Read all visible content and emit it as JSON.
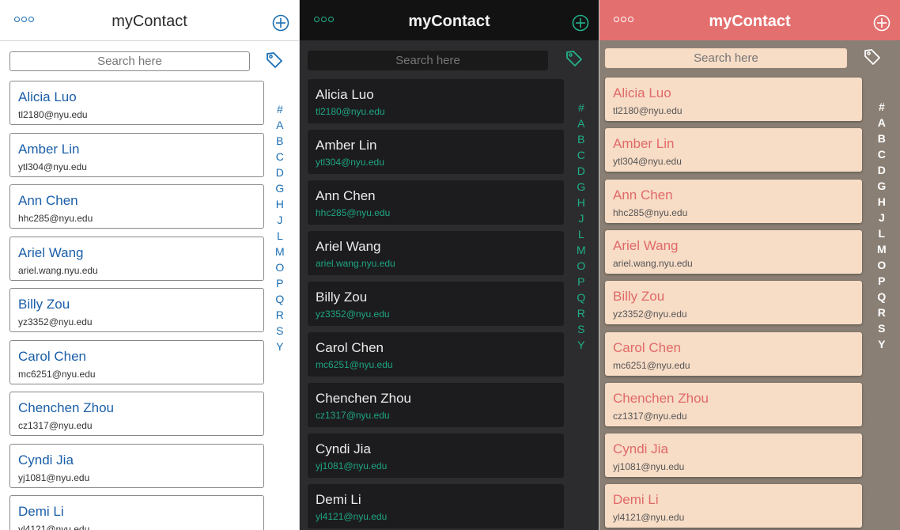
{
  "app": {
    "title": "myContact"
  },
  "search": {
    "placeholder": "Search here"
  },
  "contacts": [
    {
      "name": "Alicia Luo",
      "email": "tl2180@nyu.edu"
    },
    {
      "name": "Amber Lin",
      "email": "ytl304@nyu.edu"
    },
    {
      "name": "Ann Chen",
      "email": "hhc285@nyu.edu"
    },
    {
      "name": "Ariel Wang",
      "email": "ariel.wang.nyu.edu"
    },
    {
      "name": "Billy Zou",
      "email": "yz3352@nyu.edu"
    },
    {
      "name": "Carol Chen",
      "email": "mc6251@nyu.edu"
    },
    {
      "name": "Chenchen Zhou",
      "email": "cz1317@nyu.edu"
    },
    {
      "name": "Cyndi Jia",
      "email": "yj1081@nyu.edu"
    },
    {
      "name": "Demi Li",
      "email": "yl4121@nyu.edu"
    }
  ],
  "index_letters": [
    "#",
    "A",
    "B",
    "C",
    "D",
    "G",
    "H",
    "J",
    "L",
    "M",
    "O",
    "P",
    "Q",
    "R",
    "S",
    "Y"
  ],
  "icons": {
    "menu": "more-dots-icon",
    "add": "plus-circle-icon",
    "tag": "tag-icon"
  },
  "themes": {
    "light": {
      "accent": "#1a6fb5",
      "background": "#ffffff"
    },
    "dark": {
      "accent": "#23b08a",
      "background": "#2c2c2e"
    },
    "coral": {
      "accent": "#e46f6f",
      "card": "#f7dcc6",
      "background": "#8a7f74"
    }
  }
}
